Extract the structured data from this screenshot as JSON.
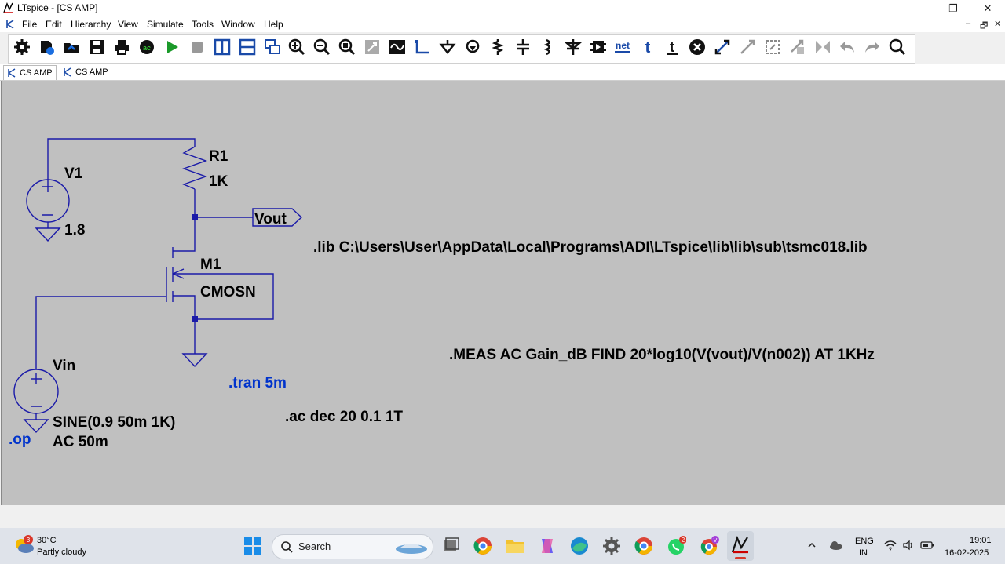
{
  "window": {
    "title": "LTspice - [CS AMP]",
    "controls": {
      "minimize": "—",
      "restore": "❐",
      "close": "✕"
    }
  },
  "menu": [
    "File",
    "Edit",
    "Hierarchy",
    "View",
    "Simulate",
    "Tools",
    "Window",
    "Help"
  ],
  "mdi_controls": {
    "minimize": "–",
    "restore": "🗗",
    "close": "✕"
  },
  "toolbar": {
    "icons": [
      "settings-icon",
      "open-file-icon",
      "open-folder-icon",
      "save-icon",
      "print-icon",
      "ac-analysis-icon",
      "run-icon",
      "stop-icon",
      "tile-vertical-icon",
      "tile-horizontal-icon",
      "cascade-icon",
      "zoom-in-icon",
      "zoom-out-icon",
      "zoom-fit-icon",
      "zoom-area-icon",
      "waveform-icon",
      "wire-icon",
      "ground-icon",
      "label-icon",
      "resistor-icon",
      "capacitor-icon",
      "inductor-icon",
      "diode-icon",
      "component-icon",
      "netlist-icon",
      "text-icon",
      "spice-directive-icon",
      "delete-icon",
      "move-icon",
      "drag-icon",
      "rotate-icon",
      "mirror-icon",
      "undo-icon",
      "redo-icon",
      "find-icon"
    ],
    "net_label": "net",
    "text_label": "t",
    "ac_label": "ac"
  },
  "tabs": [
    {
      "label": "CS AMP",
      "active": true
    },
    {
      "label": "CS AMP",
      "active": false
    }
  ],
  "schematic": {
    "v1_name": "V1",
    "v1_value": "1.8",
    "r1_name": "R1",
    "r1_value": "1K",
    "m1_name": "M1",
    "m1_model": "CMOSN",
    "vout_label": "Vout",
    "vin_name": "Vin",
    "vin_value1": "SINE(0.9 50m 1K)",
    "vin_value2": "AC 50m",
    "op_directive": ".op",
    "tran_directive": ".tran 5m",
    "ac_directive": ".ac dec 20 0.1 1T",
    "lib_directive": ".lib C:\\Users\\User\\AppData\\Local\\Programs\\ADI\\LTspice\\lib\\lib\\sub\\tsmc018.lib",
    "meas_directive": ".MEAS AC Gain_dB FIND 20*log10(V(vout)/V(n002)) AT 1KHz",
    "colors": {
      "wire": "#1a1aa8",
      "directive_blue": "#0033cc",
      "text": "#000000",
      "canvas": "#c0c0c0"
    }
  },
  "taskbar": {
    "weather_temp": "30°C",
    "weather_desc": "Partly cloudy",
    "weather_badge": "3",
    "search_label": "Search",
    "whatsapp_badge": "2",
    "chrome_badge": "V",
    "lang1": "ENG",
    "lang2": "IN",
    "time": "19:01",
    "date": "16-02-2025"
  }
}
